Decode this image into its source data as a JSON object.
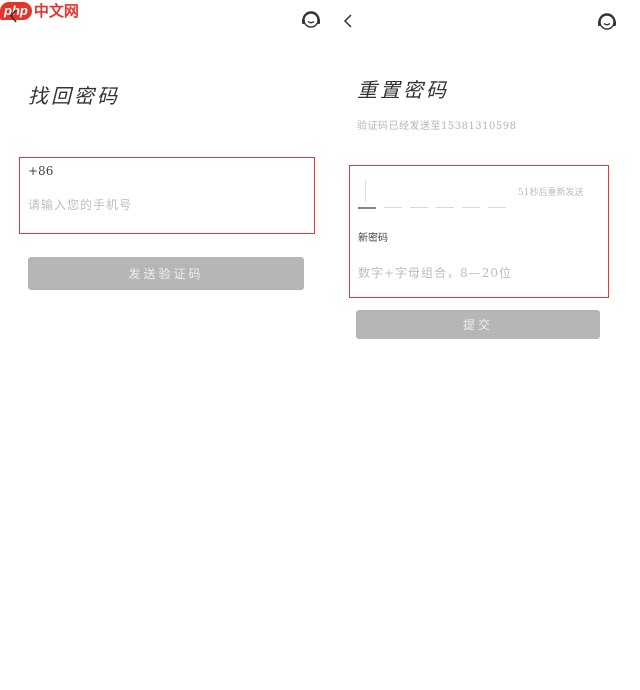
{
  "watermark": {
    "php": "php",
    "text": "中文网"
  },
  "left_screen": {
    "title": "找回密码",
    "country_code": "+86",
    "phone_placeholder": "请输入您的手机号",
    "send_code_button": "发送验证码"
  },
  "right_screen": {
    "back_icon": "‹",
    "title": "重置密码",
    "subtitle": "验证码已经发送至15381310598",
    "countdown": "51秒后重新发送",
    "code_slots": 6,
    "new_password_label": "新密码",
    "password_placeholder": "数字+字母组合，8—20位",
    "submit_button": "提交"
  },
  "icons": {
    "service": "headset-service-icon",
    "back": "chevron-left-icon"
  },
  "colors": {
    "highlight_border": "#e53935",
    "button_bg": "#b6b6b8",
    "logo_red": "#e8332b"
  }
}
